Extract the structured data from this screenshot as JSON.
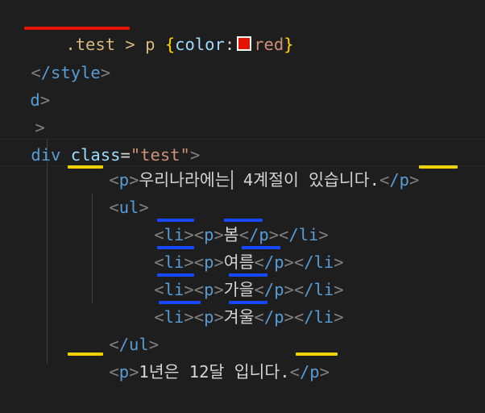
{
  "code": {
    "l1": {
      "selector": ".test > p",
      "brace_open": "{",
      "prop": "color",
      "colon": ":",
      "value": "red",
      "brace_close": "}",
      "swatch_color": "#e51400"
    },
    "l2": {
      "text": "/style",
      "lt": "<",
      "gt": ">"
    },
    "l3": {
      "text": "d",
      "gt": ">"
    },
    "l4": {
      "text": ">"
    },
    "l5": {
      "tag": "div",
      "attr": "class",
      "eq": "=",
      "str": "\"test\"",
      "gt": ">"
    },
    "l6": {
      "open_tag": "p",
      "text": "우리나라에는 4계절이 있습니다.",
      "close_tag": "/p"
    },
    "l7": {
      "tag": "ul"
    },
    "items": [
      {
        "li": "li",
        "p": "p",
        "text": "봄",
        "pc": "/p",
        "lic": "/li"
      },
      {
        "li": "li",
        "p": "p",
        "text": "여름",
        "pc": "/p",
        "lic": "/li"
      },
      {
        "li": "li",
        "p": "p",
        "text": "가을",
        "pc": "/p",
        "lic": "/li"
      },
      {
        "li": "li",
        "p": "p",
        "text": "겨울",
        "pc": "/p",
        "lic": "/li"
      }
    ],
    "l12": {
      "tag": "/ul"
    },
    "l13": {
      "open_tag": "p",
      "text": "1년은 12달 입니다.",
      "close_tag": "/p"
    },
    "lt": "<",
    "gt": ">",
    "text_before_cursor": "우리나라에는",
    "text_after_cursor": " 4계절이 있습니다."
  },
  "annotations": {
    "red_color": "#e51400",
    "yellow_color": "#f0d000",
    "blue_color": "#1548ff"
  }
}
